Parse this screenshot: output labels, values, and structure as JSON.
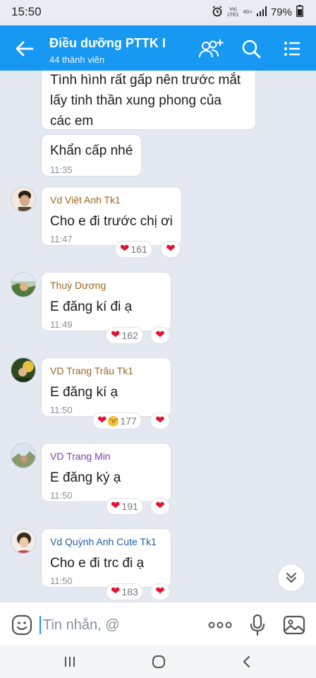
{
  "status_bar": {
    "time": "15:50",
    "battery": "79%",
    "network_top": "Vo)",
    "network_bottom": "LTE1",
    "network_4g": "4G+"
  },
  "header": {
    "title": "Điều dưỡng PTTK I",
    "subtitle": "44 thành viên"
  },
  "messages": [
    {
      "text": "Tình hình rất gấp nên trước mắt\nlấy tinh thần xung phong của\ncác em"
    },
    {
      "text": "Khẩn cấp nhé",
      "time": "11:35"
    },
    {
      "sender": "Vd Việt Anh Tk1",
      "sender_color": "#a0651f",
      "text": "Cho e đi trước chị ơi",
      "time": "11:47",
      "reaction_count": "161"
    },
    {
      "sender": "Thuỳ Dương",
      "sender_color": "#a0651f",
      "text": "E đăng kí đi ạ",
      "time": "11:49",
      "reaction_count": "162"
    },
    {
      "sender": "VD Trang Trâu Tk1",
      "sender_color": "#a0651f",
      "text": "E đăng kí ạ",
      "time": "11:50",
      "reaction_count": "177"
    },
    {
      "sender": "VD Trang Min",
      "sender_color": "#7d3fb0",
      "text": "E đăng ký ạ",
      "time": "11:50",
      "reaction_count": "191"
    },
    {
      "sender": "Vd Quỳnh Anh Cute Tk1",
      "sender_color": "#1f5fa8",
      "text": "Cho e đi trc đi ạ",
      "time": "11:50",
      "reaction_count": "183"
    }
  ],
  "input": {
    "placeholder": "Tin nhắn, @"
  },
  "colors": {
    "header": "#1798f2",
    "heart": "#e4112f",
    "chat_bg": "#e4e8f0"
  },
  "icons": [
    "back-arrow-icon",
    "add-member-icon",
    "search-icon",
    "menu-icon",
    "sticker-icon",
    "more-icon",
    "microphone-icon",
    "image-icon",
    "chevron-double-down-icon",
    "recent-apps-icon",
    "home-icon",
    "back-icon"
  ]
}
